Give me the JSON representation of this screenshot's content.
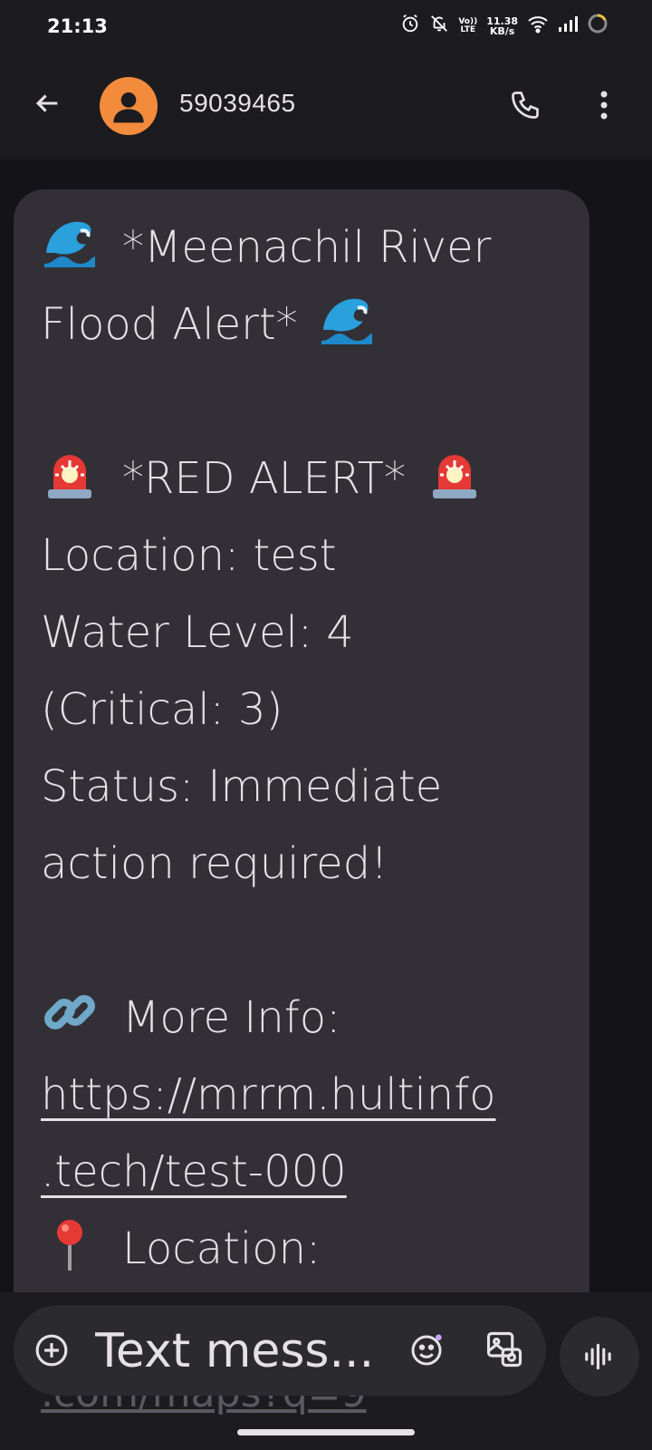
{
  "status_bar": {
    "time": "21:13",
    "network_speed_value": "11.38",
    "network_speed_unit": "KB/s",
    "volte_top": "Vo))",
    "volte_bottom": "LTE",
    "icons": [
      "alarm-icon",
      "mute-icon",
      "volte-icon",
      "wifi-icon",
      "signal-icon",
      "battery-icon"
    ]
  },
  "header": {
    "contact": "59039465",
    "avatar_color": "#f28b3c",
    "icons": [
      "back-arrow-icon",
      "person-icon",
      "phone-icon",
      "more-vert-icon"
    ]
  },
  "message": {
    "lines": [
      {
        "emoji": "wave",
        "text": "*Meenachil River"
      },
      {
        "text": "Flood Alert*",
        "emoji_after": "wave"
      },
      {
        "text": ""
      },
      {
        "emoji": "siren",
        "text": "*RED ALERT*",
        "emoji_after": "siren"
      },
      {
        "text": "Location: test"
      },
      {
        "text": "Water Level: 4"
      },
      {
        "text": "(Critical: 3)"
      },
      {
        "text": "Status: Immediate"
      },
      {
        "text": "action required!"
      },
      {
        "text": ""
      },
      {
        "emoji": "link",
        "text": "More Info:"
      },
      {
        "text": "https://mrrm.hultinfo",
        "link": true
      },
      {
        "text": ".tech/test-000",
        "link": true
      },
      {
        "emoji": "pin",
        "text": "Location:"
      }
    ],
    "peek_text": ".com/maps?q=9",
    "bubble_color": "#323036"
  },
  "composer": {
    "placeholder": "Text mess...",
    "icons": [
      "add-circle-icon",
      "emoji-icon",
      "gallery-icon",
      "voice-icon"
    ]
  }
}
